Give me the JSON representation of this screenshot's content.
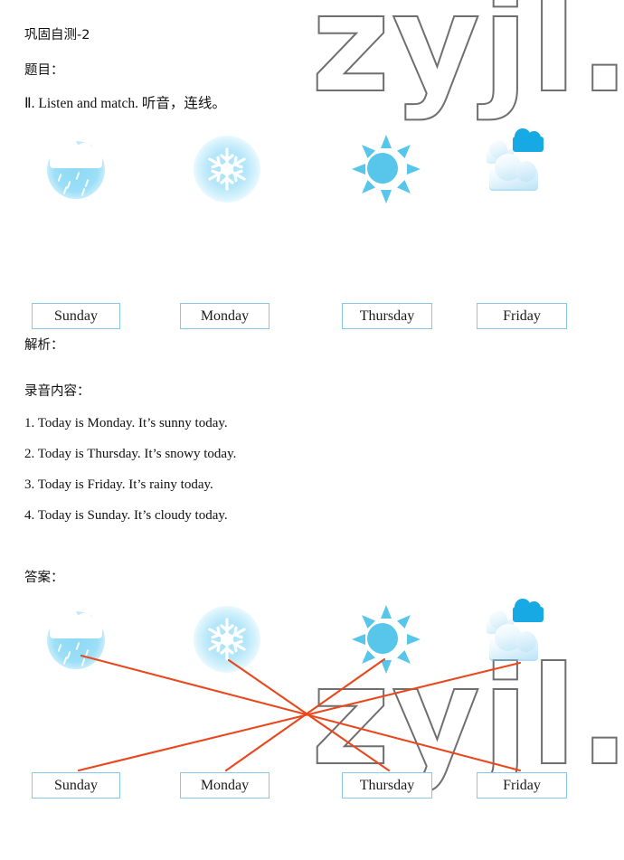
{
  "header": {
    "title": "巩固自测-2",
    "question_label": "题目：",
    "instruction": "Ⅱ. Listen and match. 听音，连线。"
  },
  "weather_icons": [
    {
      "name": "rainy-icon",
      "label": "rainy"
    },
    {
      "name": "snowy-icon",
      "label": "snowy"
    },
    {
      "name": "sunny-icon",
      "label": "sunny"
    },
    {
      "name": "cloudy-icon",
      "label": "cloudy"
    }
  ],
  "days": [
    "Sunday",
    "Monday",
    "Thursday",
    "Friday"
  ],
  "analysis": {
    "heading": "解析：",
    "transcript_label": "录音内容：",
    "transcript": [
      "1. Today is Monday. It’s sunny today.",
      "2. Today is Thursday. It’s snowy today.",
      "3. Today is Friday. It’s rainy today.",
      "4. Today is Sunday. It’s cloudy today."
    ]
  },
  "answer": {
    "heading": "答案：",
    "matches": [
      {
        "icon": "rainy-icon",
        "day": "Friday"
      },
      {
        "icon": "snowy-icon",
        "day": "Thursday"
      },
      {
        "icon": "sunny-icon",
        "day": "Monday"
      },
      {
        "icon": "cloudy-icon",
        "day": "Sunday"
      }
    ],
    "line_color": "#e8481c"
  },
  "watermark": {
    "text": "zyjl.c",
    "color": "#6f6f6f"
  },
  "colors": {
    "box_border": "#84c9e8",
    "icon_blue": "#58c5ea",
    "cloud_blue": "#17a9e3"
  }
}
